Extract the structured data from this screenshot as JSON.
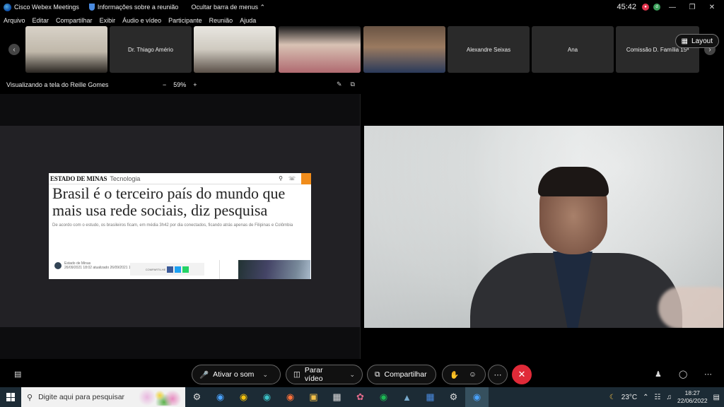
{
  "titlebar": {
    "app_name": "Cisco Webex Meetings",
    "meeting_info": "Informações sobre a reunião",
    "hide_menu": "Ocultar barra de menus",
    "timer": "45:42"
  },
  "menubar": [
    "Arquivo",
    "Editar",
    "Compartilhar",
    "Exibir",
    "Áudio e vídeo",
    "Participante",
    "Reunião",
    "Ajuda"
  ],
  "participants": [
    {
      "name": "",
      "kind": "video"
    },
    {
      "name": "Dr. Thiago Amério",
      "kind": "name"
    },
    {
      "name": "",
      "kind": "video"
    },
    {
      "name": "",
      "kind": "video"
    },
    {
      "name": "",
      "kind": "video"
    },
    {
      "name": "Alexandre Seixas",
      "kind": "name"
    },
    {
      "name": "Ana",
      "kind": "name"
    },
    {
      "name": "Comissão D. Família 15ª",
      "kind": "name"
    }
  ],
  "layout_button": "Layout",
  "share": {
    "viewing": "Visualizando a tela do Reille Gomes",
    "zoom": "59%",
    "zoom_out": "−",
    "zoom_in": "+"
  },
  "article": {
    "brand": "ESTADO DE MINAS",
    "section": "Tecnologia",
    "title": "Brasil é o terceiro país do mundo que mais usa rede sociais, diz pesquisa",
    "subtitle": "De acordo com o estudo, os brasileiros ficam, em média 3h42 por dia conectados, ficando atrás apenas de Filipinas e Colômbia",
    "author": "Estado de Minas",
    "date": "26/09/2021 18:02",
    "updated": "atualizado 26/09/2021 11:14",
    "share_label": "COMPARTILHE"
  },
  "controls": {
    "unmute": "Ativar o som",
    "stop_video": "Parar vídeo",
    "share": "Compartilhar"
  },
  "taskbar": {
    "search_placeholder": "Digite aqui para pesquisar",
    "temperature": "23°C",
    "time": "18:27",
    "date": "22/06/2022"
  }
}
